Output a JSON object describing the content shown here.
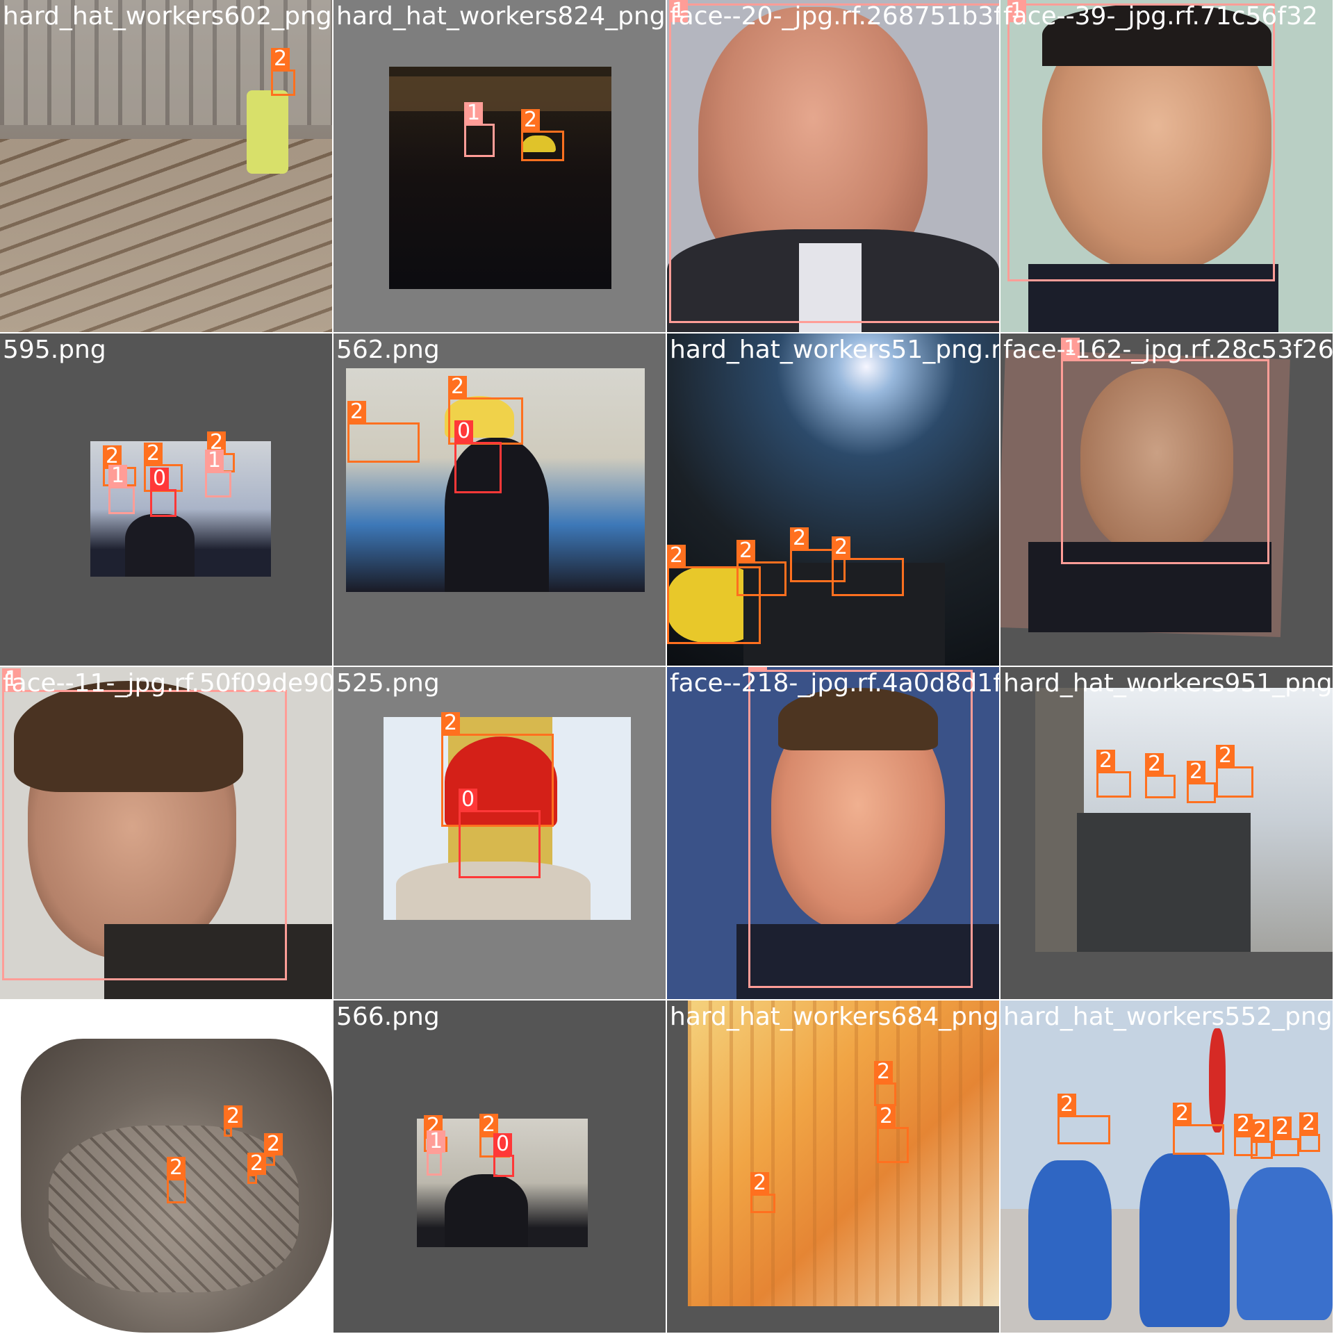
{
  "classes": {
    "0": {
      "color": "#ff3838"
    },
    "1": {
      "color": "#ff9d97"
    },
    "2": {
      "color": "#ff701f"
    }
  },
  "tiles": [
    {
      "filename": "hard_hat_workers602_png.rf.2e71f8f266d951",
      "labels": [
        "2"
      ]
    },
    {
      "filename": "hard_hat_workers824_png.rf.5d5200e927af",
      "labels": [
        "1",
        "2"
      ]
    },
    {
      "filename": "face--20-_jpg.rf.268751b3f8615e0d395ab",
      "labels": [
        "1"
      ]
    },
    {
      "filename": "face--39-_jpg.rf.71c56f32",
      "labels": [
        "1"
      ]
    },
    {
      "filename": "595.png",
      "labels": [
        "2",
        "1",
        "2",
        "0",
        "2",
        "1"
      ]
    },
    {
      "filename": "562.png",
      "labels": [
        "2",
        "2",
        "0"
      ]
    },
    {
      "filename": "hard_hat_workers51_png.rf.7a5b4562",
      "labels": [
        "2",
        "2",
        "2",
        "2"
      ]
    },
    {
      "filename": "face--162-_jpg.rf.28c53f260f",
      "labels": [
        "1"
      ]
    },
    {
      "filename": "face--11-_jpg.rf.50f09de9094125ec954bb447",
      "labels": [
        "1"
      ]
    },
    {
      "filename": "525.png",
      "labels": [
        "2",
        "0"
      ]
    },
    {
      "filename": "face--218-_jpg.rf.4a0d8d1fb88a4e3311282",
      "labels": [
        "1"
      ]
    },
    {
      "filename": "hard_hat_workers951_png.rf",
      "labels": [
        "2",
        "2",
        "2",
        "2"
      ]
    },
    {
      "filename": "hard_hat_workers4973_png.rf.566e449c16cdbf",
      "labels": [
        "2",
        "2",
        "2",
        "2"
      ]
    },
    {
      "filename": "566.png",
      "labels": [
        "2",
        "1",
        "2",
        "0"
      ]
    },
    {
      "filename": "hard_hat_workers684_png.rf.1a7",
      "labels": [
        "2",
        "2",
        "2"
      ]
    },
    {
      "filename": "hard_hat_workers552_png.rf",
      "labels": [
        "2",
        "2",
        "2",
        "2",
        "2",
        "2"
      ]
    }
  ]
}
